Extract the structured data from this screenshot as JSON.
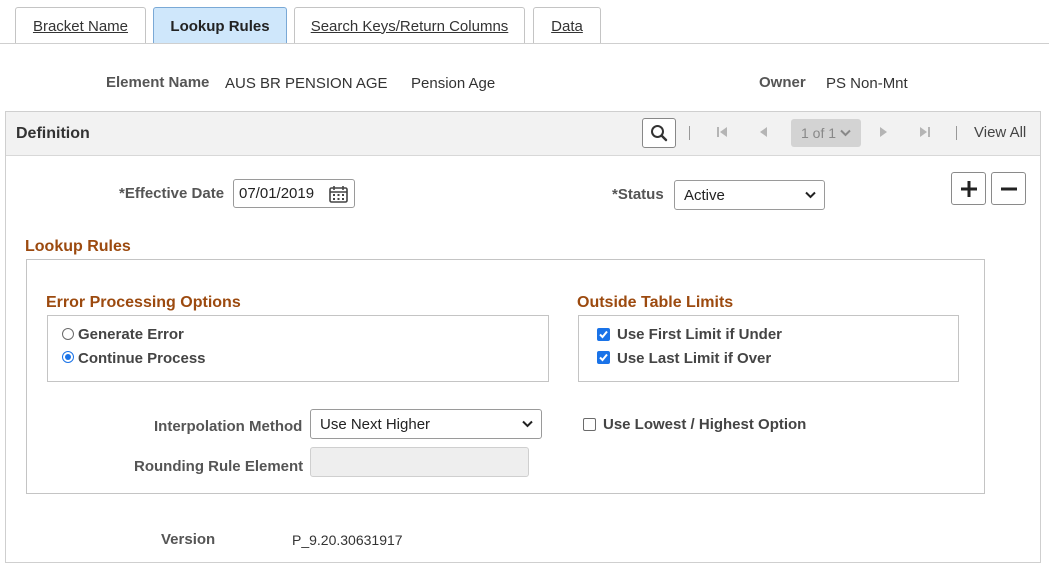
{
  "tabs": [
    {
      "label": "Bracket Name",
      "active": false
    },
    {
      "label": "Lookup Rules",
      "active": true
    },
    {
      "label": "Search Keys/Return Columns",
      "active": false
    },
    {
      "label": "Data",
      "active": false
    }
  ],
  "header": {
    "element_name_label": "Element Name",
    "element_name_value": "AUS BR PENSION AGE",
    "element_desc": "Pension Age",
    "owner_label": "Owner",
    "owner_value": "PS Non-Mnt"
  },
  "definition": {
    "title": "Definition",
    "pager_text": "1 of 1",
    "view_all": "View All",
    "search_icon": "search-icon",
    "first_icon": "first-page-icon",
    "prev_icon": "previous-icon",
    "next_icon": "next-icon",
    "last_icon": "last-page-icon"
  },
  "form": {
    "effective_date_label": "*Effective Date",
    "effective_date_value": "07/01/2019",
    "status_label": "*Status",
    "status_value": "Active",
    "add_icon": "plus-icon",
    "remove_icon": "minus-icon"
  },
  "lookup_rules": {
    "title": "Lookup Rules",
    "error_processing": {
      "title": "Error Processing Options",
      "options": [
        {
          "label": "Generate Error",
          "selected": false
        },
        {
          "label": "Continue Process",
          "selected": true
        }
      ]
    },
    "outside_limits": {
      "title": "Outside Table Limits",
      "options": [
        {
          "label": "Use First Limit if Under",
          "checked": true
        },
        {
          "label": "Use Last Limit if Over",
          "checked": true
        }
      ]
    },
    "interpolation_label": "Interpolation Method",
    "interpolation_value": "Use Next Higher",
    "lowest_highest_label": "Use Lowest / Highest Option",
    "lowest_highest_checked": false,
    "rounding_label": "Rounding Rule Element",
    "rounding_value": ""
  },
  "version": {
    "label": "Version",
    "value": "P_9.20.30631917"
  },
  "colors": {
    "section_title": "#9c4a0f",
    "active_tab_bg": "#cfe7fb",
    "accent": "#1a73e8"
  }
}
